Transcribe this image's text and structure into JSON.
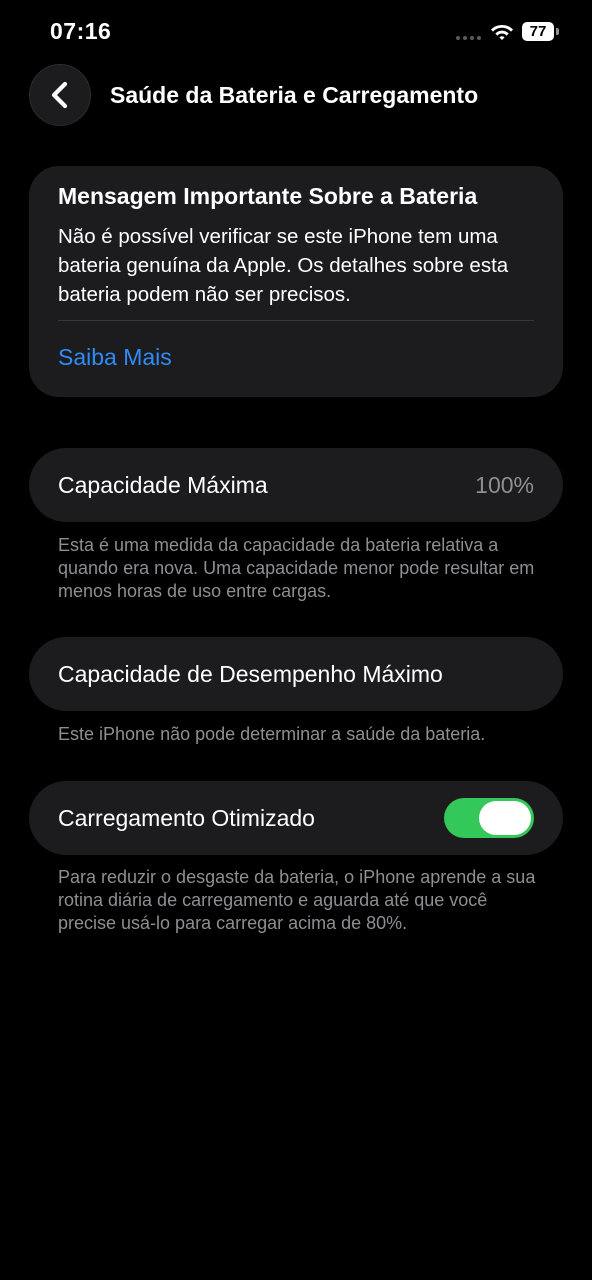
{
  "status_bar": {
    "time": "07:16",
    "battery_level": "77"
  },
  "nav": {
    "title": "Saúde da Bateria e Carregamento"
  },
  "message_card": {
    "title": "Mensagem Importante Sobre a Bateria",
    "body": "Não é possível verificar se este iPhone tem uma bateria genuína da Apple. Os detalhes sobre esta bateria podem não ser precisos.",
    "link": "Saiba Mais"
  },
  "max_capacity": {
    "label": "Capacidade Máxima",
    "value": "100%",
    "footnote": "Esta é uma medida da capacidade da bateria relativa a quando era nova. Uma capacidade menor pode resultar em menos horas de uso entre cargas."
  },
  "peak_performance": {
    "label": "Capacidade de Desempenho Máximo",
    "footnote": "Este iPhone não pode determinar a saúde da bateria."
  },
  "optimized_charging": {
    "label": "Carregamento Otimizado",
    "enabled": true,
    "footnote": "Para reduzir o desgaste da bateria, o iPhone aprende a sua rotina diária de carregamento e aguarda até que você precise usá-lo para carregar acima de 80%."
  },
  "colors": {
    "background": "#000000",
    "card": "#1c1c1e",
    "link": "#2f8cf7",
    "secondary_text": "#8e8e93",
    "toggle_on": "#34c759"
  },
  "icons": [
    "wifi-icon",
    "battery-icon",
    "chevron-left-icon"
  ]
}
